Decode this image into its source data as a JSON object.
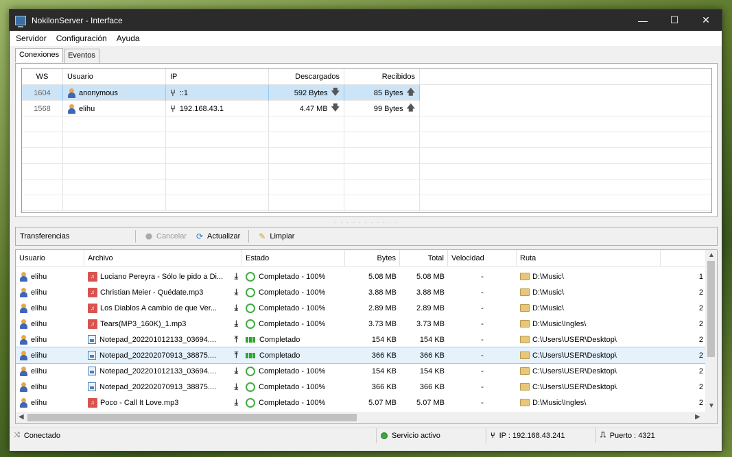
{
  "window": {
    "title": "NokilonServer - Interface",
    "minimize": "—",
    "maximize": "☐",
    "close": "✕"
  },
  "menu": [
    "Servidor",
    "Configuración",
    "Ayuda"
  ],
  "tabs": [
    "Conexiones",
    "Eventos"
  ],
  "connections": {
    "headers": [
      "WS",
      "Usuario",
      "IP",
      "Descargados",
      "Recibidos"
    ],
    "rows": [
      {
        "ws": "1604",
        "user": "anonymous",
        "ip": "::1",
        "down": "592 Bytes",
        "recv": "85 Bytes",
        "selected": true
      },
      {
        "ws": "1568",
        "user": "elihu",
        "ip": "192.168.43.1",
        "down": "4.47 MB",
        "recv": "99 Bytes",
        "selected": false
      }
    ]
  },
  "transfers_toolbar": {
    "title": "Transferencias",
    "cancel": "Cancelar",
    "refresh": "Actualizar",
    "clear": "Limpiar"
  },
  "transfers": {
    "headers": [
      "Usuario",
      "Archivo",
      "Estado",
      "Bytes",
      "Total",
      "Velocidad",
      "Ruta"
    ],
    "rows": [
      {
        "user": "elihu",
        "file": "Luciano Pereyra - Sólo le pido a Di...",
        "type": "audio",
        "dir": "down",
        "status": "Completado - 100%",
        "st": "circle",
        "bytes": "5.08 MB",
        "total": "5.08 MB",
        "speed": "-",
        "path": "D:\\Music\\",
        "extra": "1"
      },
      {
        "user": "elihu",
        "file": "Christian Meier - Quédate.mp3",
        "type": "audio",
        "dir": "down",
        "status": "Completado - 100%",
        "st": "circle",
        "bytes": "3.88 MB",
        "total": "3.88 MB",
        "speed": "-",
        "path": "D:\\Music\\",
        "extra": "2"
      },
      {
        "user": "elihu",
        "file": "Los Diablos  A cambio de que  Ver...",
        "type": "audio",
        "dir": "down",
        "status": "Completado - 100%",
        "st": "circle",
        "bytes": "2.89 MB",
        "total": "2.89 MB",
        "speed": "-",
        "path": "D:\\Music\\",
        "extra": "2"
      },
      {
        "user": "elihu",
        "file": "Tears(MP3_160K)_1.mp3",
        "type": "audio",
        "dir": "down",
        "status": "Completado - 100%",
        "st": "circle",
        "bytes": "3.73 MB",
        "total": "3.73 MB",
        "speed": "-",
        "path": "D:\\Music\\Ingles\\",
        "extra": "2"
      },
      {
        "user": "elihu",
        "file": "Notepad_202201012133_03694....",
        "type": "img",
        "dir": "up",
        "status": "Completado",
        "st": "bars",
        "bytes": "154 KB",
        "total": "154 KB",
        "speed": "-",
        "path": "C:\\Users\\USER\\Desktop\\",
        "extra": "2"
      },
      {
        "user": "elihu",
        "file": "Notepad_202202070913_38875....",
        "type": "img",
        "dir": "up",
        "status": "Completado",
        "st": "bars",
        "bytes": "366 KB",
        "total": "366 KB",
        "speed": "-",
        "path": "C:\\Users\\USER\\Desktop\\",
        "extra": "2",
        "selected": true
      },
      {
        "user": "elihu",
        "file": "Notepad_202201012133_03694....",
        "type": "img",
        "dir": "down",
        "status": "Completado - 100%",
        "st": "circle",
        "bytes": "154 KB",
        "total": "154 KB",
        "speed": "-",
        "path": "C:\\Users\\USER\\Desktop\\",
        "extra": "2"
      },
      {
        "user": "elihu",
        "file": "Notepad_202202070913_38875....",
        "type": "img",
        "dir": "down",
        "status": "Completado - 100%",
        "st": "circle",
        "bytes": "366 KB",
        "total": "366 KB",
        "speed": "-",
        "path": "C:\\Users\\USER\\Desktop\\",
        "extra": "2"
      },
      {
        "user": "elihu",
        "file": "Poco - Call It Love.mp3",
        "type": "audio",
        "dir": "down",
        "status": "Completado - 100%",
        "st": "circle",
        "bytes": "5.07 MB",
        "total": "5.07 MB",
        "speed": "-",
        "path": "D:\\Music\\Ingles\\",
        "extra": "2"
      }
    ]
  },
  "status": {
    "connection": "Conectado",
    "service": "Servicio activo",
    "ip": "IP : 192.168.43.241",
    "port": "Puerto : 4321"
  }
}
